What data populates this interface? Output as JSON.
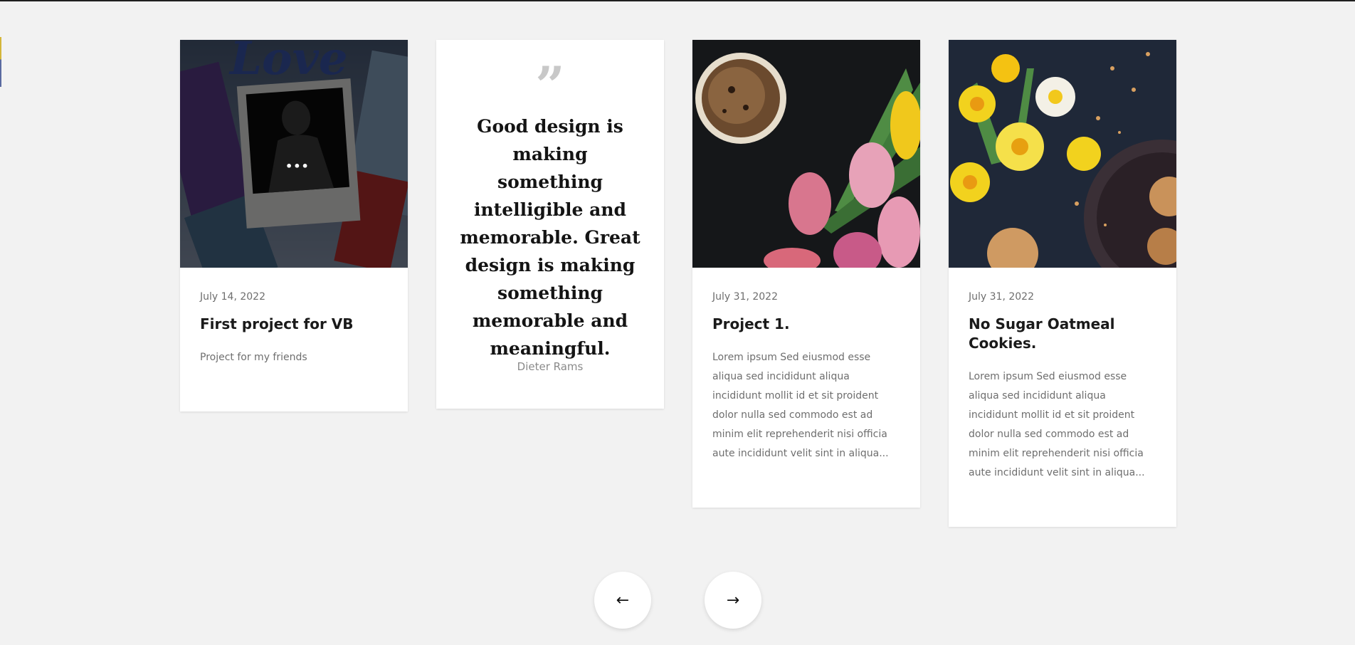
{
  "cards": [
    {
      "type": "post",
      "date": "July 14, 2022",
      "title": "First project for VB",
      "excerpt": "Project for my friends",
      "image_icon": "love-polaroid-image",
      "overlay_menu": "•••"
    },
    {
      "type": "quote",
      "quote_mark": "”",
      "text": "Good design is making something intelligible and memorable. Great design is making something memorable and meaningful.",
      "author": "Dieter Rams"
    },
    {
      "type": "post",
      "date": "July 31, 2022",
      "title": "Project 1.",
      "excerpt": "Lorem ipsum Sed eiusmod esse aliqua sed incididunt aliqua incididunt mollit id et sit proident dolor nulla sed commodo est ad minim elit reprehenderit nisi officia aute incididunt velit sint in aliqua...",
      "image_icon": "coffee-tulips-image"
    },
    {
      "type": "post",
      "date": "July 31, 2022",
      "title": "No Sugar Oatmeal Cookies.",
      "excerpt": "Lorem ipsum Sed eiusmod esse aliqua sed incididunt aliqua incididunt mollit id et sit proident dolor nulla sed commodo est ad minim elit reprehenderit nisi officia aute incididunt velit sint in aliqua...",
      "image_icon": "daffodils-cookies-image"
    }
  ],
  "navigation": {
    "prev_label": "←",
    "next_label": "→",
    "prev_icon": "arrow-left-icon",
    "next_icon": "arrow-right-icon"
  },
  "colors": {
    "page_background": "#f2f2f2",
    "card_background": "#ffffff",
    "title_text": "#1a1a1a",
    "muted_text": "#6e6e6e",
    "quote_mark": "#c8c8c8"
  }
}
